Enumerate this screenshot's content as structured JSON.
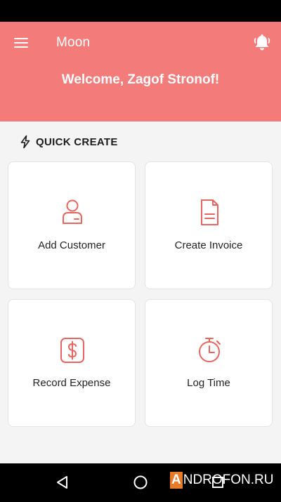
{
  "header": {
    "title": "Moon",
    "welcome": "Welcome, Zagof Stronof!"
  },
  "section": {
    "label": "QUICK CREATE"
  },
  "cards": [
    {
      "label": "Add Customer",
      "icon": "customer-icon"
    },
    {
      "label": "Create Invoice",
      "icon": "invoice-icon"
    },
    {
      "label": "Record Expense",
      "icon": "expense-icon"
    },
    {
      "label": "Log Time",
      "icon": "timer-icon"
    }
  ],
  "colors": {
    "accent": "#f37c7a",
    "icon": "#e8645f"
  },
  "watermark": {
    "first_letter": "A",
    "rest": "NDROFON.RU"
  }
}
